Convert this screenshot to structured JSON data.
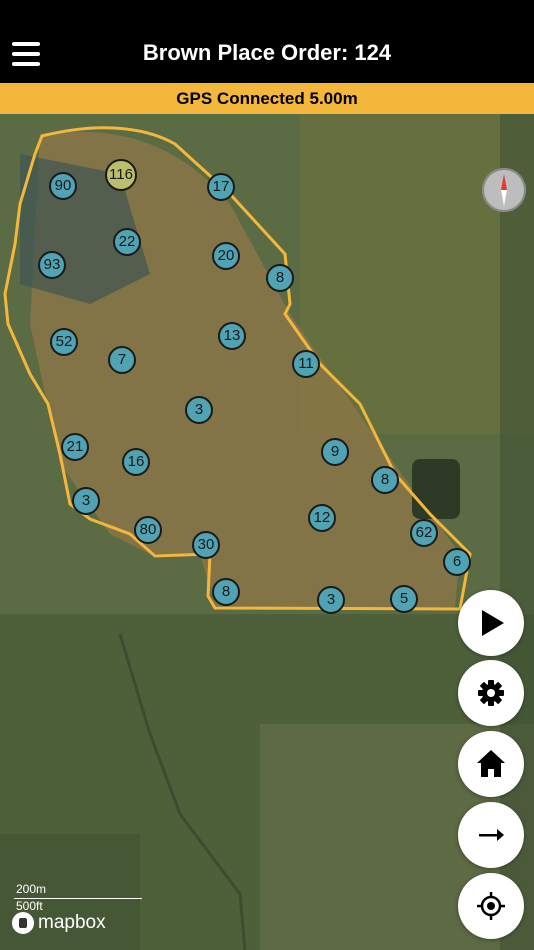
{
  "header": {
    "title": "Brown Place Order: 124",
    "menu_icon": "hamburger-menu-icon"
  },
  "status": {
    "gps_text": "GPS Connected 5.00m",
    "color": "#f3b73b"
  },
  "map": {
    "boundary_color": "#f3b73b",
    "pin_color": "#4fa3b3",
    "highlight_pin_color": "#b9bf6c",
    "pins": [
      {
        "label": "90"
      },
      {
        "label": "116",
        "highlight": true
      },
      {
        "label": "17"
      },
      {
        "label": "22"
      },
      {
        "label": "93"
      },
      {
        "label": "20"
      },
      {
        "label": "8"
      },
      {
        "label": "52"
      },
      {
        "label": "7"
      },
      {
        "label": "13"
      },
      {
        "label": "11"
      },
      {
        "label": "3"
      },
      {
        "label": "21"
      },
      {
        "label": "16"
      },
      {
        "label": "9"
      },
      {
        "label": "8"
      },
      {
        "label": "3"
      },
      {
        "label": "80"
      },
      {
        "label": "12"
      },
      {
        "label": "62"
      },
      {
        "label": "30"
      },
      {
        "label": "6"
      },
      {
        "label": "8"
      },
      {
        "label": "3"
      },
      {
        "label": "5"
      }
    ],
    "scale": {
      "metric": "200m",
      "imperial": "500ft"
    },
    "attribution": "mapbox"
  },
  "controls": {
    "compass_icon": "compass-icon",
    "buttons": [
      {
        "name": "play-button",
        "icon": "play-icon"
      },
      {
        "name": "settings-button",
        "icon": "gear-icon"
      },
      {
        "name": "home-button",
        "icon": "home-icon"
      },
      {
        "name": "next-button",
        "icon": "arrow-right-icon"
      },
      {
        "name": "locate-button",
        "icon": "crosshair-icon"
      }
    ]
  }
}
